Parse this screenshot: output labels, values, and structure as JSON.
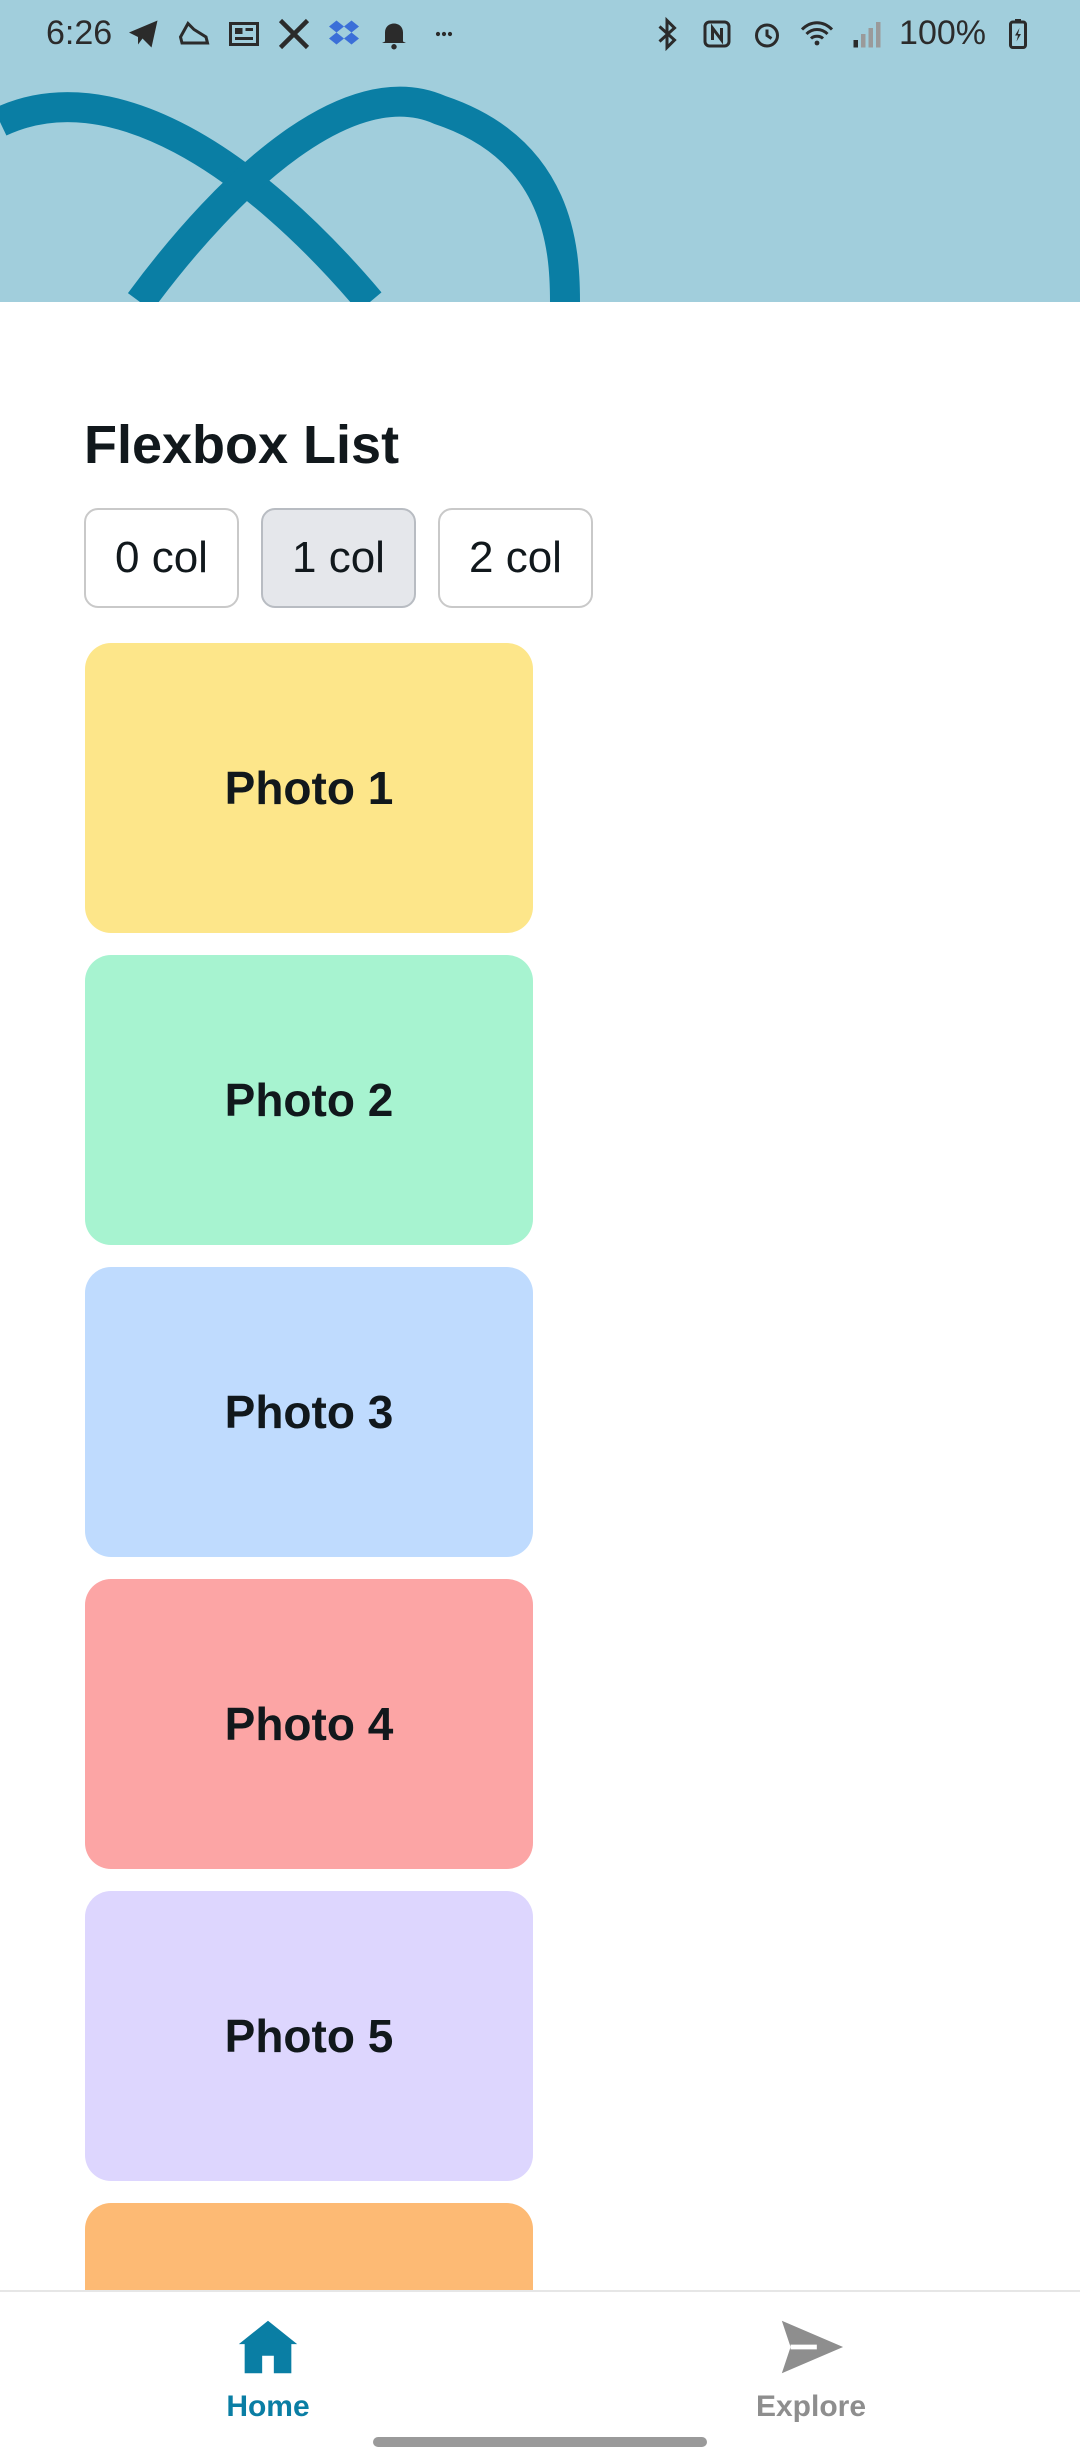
{
  "status_bar": {
    "time": "6:26",
    "battery": "100%",
    "left_icons": [
      "telegram-icon",
      "shoe-icon",
      "news-icon",
      "x-icon",
      "dropbox-icon",
      "bell-icon",
      "more-icon"
    ],
    "right_icons": [
      "bluetooth-icon",
      "nfc-icon",
      "alarm-icon",
      "wifi-icon",
      "signal-icon",
      "battery-icon"
    ]
  },
  "header": {
    "background_color": "#a1cedc",
    "logo_color": "#0a7ea4",
    "logo_icon": "react-logo-icon"
  },
  "page": {
    "title": "Flexbox List"
  },
  "column_options": [
    {
      "label": "0 col",
      "selected": false
    },
    {
      "label": "1 col",
      "selected": true
    },
    {
      "label": "2 col",
      "selected": false
    }
  ],
  "photos": [
    {
      "label": "Photo 1",
      "color": "#fde68a"
    },
    {
      "label": "Photo 2",
      "color": "#a7f3d0"
    },
    {
      "label": "Photo 3",
      "color": "#bfdbfe"
    },
    {
      "label": "Photo 4",
      "color": "#fca5a5"
    },
    {
      "label": "Photo 5",
      "color": "#ddd6fe"
    },
    {
      "label": "",
      "color": "#fdba74"
    }
  ],
  "tabs": [
    {
      "label": "Home",
      "icon": "house-icon",
      "active": true
    },
    {
      "label": "Explore",
      "icon": "paper-plane-icon",
      "active": false
    }
  ],
  "colors": {
    "accent": "#0a7ea4",
    "inactive_tab": "#8e8e8e"
  }
}
